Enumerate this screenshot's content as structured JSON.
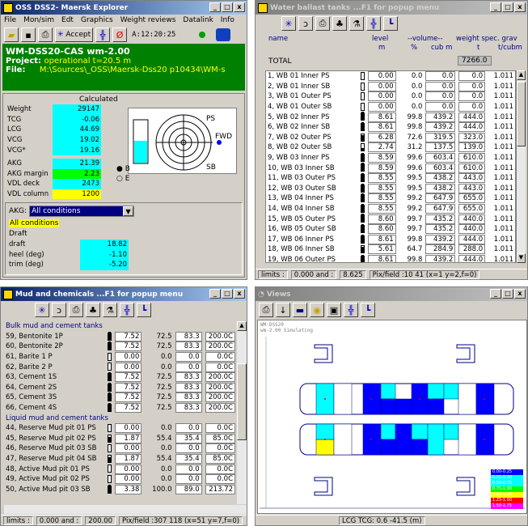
{
  "explorer": {
    "title": "OSS DSS2- Maersk Explorer",
    "menu": [
      "File",
      "Mon/sim",
      "Edt",
      "Graphics",
      "Weight reviews",
      "Datalink",
      "Info"
    ],
    "accept_label": "Accept",
    "time": "A:12:20:25",
    "header_name": "WM-DSS20-CAS wm-2.00",
    "project_label": "Project:",
    "project_value": "operational t=20.5 m",
    "file_label": "File:",
    "file_value": "M:\\Sources\\_OSS\\Maersk-Dss20 p10434\\WM-s",
    "calculated_label": "Calculated",
    "rows": [
      {
        "label": "Weight",
        "value": "29147"
      },
      {
        "label": "TCG",
        "value": "-0.06"
      },
      {
        "label": "LCG",
        "value": "44.69"
      },
      {
        "label": "VCG",
        "value": "19.02"
      },
      {
        "label": "VCG*",
        "value": "19.16"
      }
    ],
    "rows2": [
      {
        "label": "AKG",
        "value": "21.39",
        "color": "cyan"
      },
      {
        "label": "AKG margin",
        "value": "2.23",
        "color": "green"
      },
      {
        "label": "VDL deck",
        "value": "2473",
        "color": "cyan"
      },
      {
        "label": "VDL column",
        "value": "1200",
        "color": "yellow"
      }
    ],
    "compass": {
      "ps": "PS",
      "fwd": "FWD",
      "sb": "SB"
    },
    "radio_b": "B",
    "radio_e": "E",
    "akg_label": "AKG:",
    "akg_select": "All conditions",
    "all_conditions": "All conditions",
    "draft_header": "Draft",
    "draft_rows": [
      {
        "label": "draft",
        "value": "18.82"
      },
      {
        "label": "heel (deg)",
        "value": "-1.10"
      },
      {
        "label": "trim (deg)",
        "value": "-5.20"
      }
    ]
  },
  "ballast": {
    "title": "Water ballast tanks ...F1 for popup menu",
    "headers": {
      "name": "name",
      "level": "level",
      "level_unit": "m",
      "volume": "--volume--",
      "pct": "%",
      "cubm": "cub m",
      "weight": "weight spec. grav",
      "t": "t",
      "tcubm": "t/cubm"
    },
    "total_label": "TOTAL",
    "total_value": "7266.0",
    "rows": [
      {
        "name": "1, WB 01 Inner PS",
        "lv": "0.00",
        "pct": "0.0",
        "cub": "0.0",
        "w": "0.0",
        "g": "1.011",
        "fill": 0
      },
      {
        "name": "2, WB 01 Inner SB",
        "lv": "0.00",
        "pct": "0.0",
        "cub": "0.0",
        "w": "0.0",
        "g": "1.011",
        "fill": 0
      },
      {
        "name": "3, WB 01 Outer PS",
        "lv": "0.00",
        "pct": "0.0",
        "cub": "0.0",
        "w": "0.0",
        "g": "1.011",
        "fill": 0
      },
      {
        "name": "4, WB 01 Outer SB",
        "lv": "0.00",
        "pct": "0.0",
        "cub": "0.0",
        "w": "0.0",
        "g": "1.011",
        "fill": 0
      },
      {
        "name": "5, WB 02 Inner PS",
        "lv": "8.61",
        "pct": "99.8",
        "cub": "439.2",
        "w": "444.0",
        "g": "1.011",
        "fill": 1
      },
      {
        "name": "6, WB 02 Inner SB",
        "lv": "8.61",
        "pct": "99.8",
        "cub": "439.2",
        "w": "444.0",
        "g": "1.011",
        "fill": 1
      },
      {
        "name": "7, WB 02 Outer PS",
        "lv": "6.28",
        "pct": "72.6",
        "cub": "319.5",
        "w": "323.0",
        "g": "1.011",
        "fill": 0.73
      },
      {
        "name": "8, WB 02 Outer SB",
        "lv": "2.74",
        "pct": "31.2",
        "cub": "137.5",
        "w": "139.0",
        "g": "1.011",
        "fill": 0.31
      },
      {
        "name": "9, WB 03 Inner PS",
        "lv": "8.59",
        "pct": "99.6",
        "cub": "603.4",
        "w": "610.0",
        "g": "1.011",
        "fill": 1
      },
      {
        "name": "10, WB 03 Inner SB",
        "lv": "8.59",
        "pct": "99.6",
        "cub": "603.4",
        "w": "610.0",
        "g": "1.011",
        "fill": 1
      },
      {
        "name": "11, WB 03 Outer PS",
        "lv": "8.55",
        "pct": "99.5",
        "cub": "438.2",
        "w": "443.0",
        "g": "1.011",
        "fill": 1
      },
      {
        "name": "12, WB 03 Outer SB",
        "lv": "8.55",
        "pct": "99.5",
        "cub": "438.2",
        "w": "443.0",
        "g": "1.011",
        "fill": 1
      },
      {
        "name": "13, WB 04 Inner PS",
        "lv": "8.55",
        "pct": "99.2",
        "cub": "647.9",
        "w": "655.0",
        "g": "1.011",
        "fill": 1
      },
      {
        "name": "14, WB 04 Inner SB",
        "lv": "8.55",
        "pct": "99.2",
        "cub": "647.9",
        "w": "655.0",
        "g": "1.011",
        "fill": 1
      },
      {
        "name": "15, WB 05 Outer PS",
        "lv": "8.60",
        "pct": "99.7",
        "cub": "435.2",
        "w": "440.0",
        "g": "1.011",
        "fill": 1
      },
      {
        "name": "16, WB 05 Outer SB",
        "lv": "8.60",
        "pct": "99.7",
        "cub": "435.2",
        "w": "440.0",
        "g": "1.011",
        "fill": 1
      },
      {
        "name": "17, WB 06 Inner PS",
        "lv": "8.61",
        "pct": "99.8",
        "cub": "439.2",
        "w": "444.0",
        "g": "1.011",
        "fill": 1
      },
      {
        "name": "18, WB 06 Inner SB",
        "lv": "5.61",
        "pct": "64.7",
        "cub": "284.9",
        "w": "288.0",
        "g": "1.011",
        "fill": 0.65
      },
      {
        "name": "19, WB 06 Outer PS",
        "lv": "8.61",
        "pct": "99.8",
        "cub": "439.2",
        "w": "444.0",
        "g": "1.011",
        "fill": 1
      }
    ],
    "status": {
      "limits": "limits :",
      "range": "0.000 and :",
      "max": "8.625",
      "pix": "Pix/field :10  41 (x=1 y=2,f=0)"
    }
  },
  "mud": {
    "title": "Mud and chemicals ...F1 for popup menu",
    "sections": [
      {
        "header": "Bulk mud and cement tanks",
        "rows": [
          {
            "name": "59, Bentonite 1P",
            "a": "7.52",
            "b": "72.5",
            "c": "83.3",
            "d": "200.0C",
            "fill": 1
          },
          {
            "name": "60, Bentonite 2P",
            "a": "7.52",
            "b": "72.5",
            "c": "83.3",
            "d": "200.0C",
            "fill": 1
          },
          {
            "name": "61, Barite 1 P",
            "a": "0.00",
            "b": "0.0",
            "c": "0.0",
            "d": "0.0C",
            "fill": 0
          },
          {
            "name": "62, Barite 2 P",
            "a": "0.00",
            "b": "0.0",
            "c": "0.0",
            "d": "0.0C",
            "fill": 0
          },
          {
            "name": "63, Cement 1S",
            "a": "7.52",
            "b": "72.5",
            "c": "83.3",
            "d": "200.0C",
            "fill": 1
          },
          {
            "name": "64, Cement 2S",
            "a": "7.52",
            "b": "72.5",
            "c": "83.3",
            "d": "200.0C",
            "fill": 1
          },
          {
            "name": "65, Cement 3S",
            "a": "7.52",
            "b": "72.5",
            "c": "83.3",
            "d": "200.0C",
            "fill": 1
          },
          {
            "name": "66, Cement 4S",
            "a": "7.52",
            "b": "72.5",
            "c": "83.3",
            "d": "200.0C",
            "fill": 1
          }
        ]
      },
      {
        "header": "Liquid mud and cement tanks",
        "rows": [
          {
            "name": "44, Reserve Mud pit 01 PS",
            "a": "0.00",
            "b": "0.0",
            "c": "0.0",
            "d": "0.0C",
            "fill": 0
          },
          {
            "name": "45, Reserve Mud pit 02 PS",
            "a": "1.87",
            "b": "55.4",
            "c": "35.4",
            "d": "85.0C",
            "fill": 0.55
          },
          {
            "name": "46, Reserve Mud pit 03 SB",
            "a": "0.00",
            "b": "0.0",
            "c": "0.0",
            "d": "0.0C",
            "fill": 0
          },
          {
            "name": "47, Reserve Mud pit 04 SB",
            "a": "1.87",
            "b": "55.4",
            "c": "35.4",
            "d": "85.0C",
            "fill": 0.55
          },
          {
            "name": "48, Active Mud pit 01 PS",
            "a": "0.00",
            "b": "0.0",
            "c": "0.0",
            "d": "0.0C",
            "fill": 0
          },
          {
            "name": "49, Active Mud pit 02 PS",
            "a": "0.00",
            "b": "0.0",
            "c": "0.0",
            "d": "0.0C",
            "fill": 0
          },
          {
            "name": "50, Active Mud pit 03 SB",
            "a": "3.38",
            "b": "100.0",
            "c": "89.0",
            "d": "213.72",
            "fill": 1
          }
        ]
      }
    ],
    "status": {
      "limits": "limits :",
      "range": "0.000 and :",
      "max": "200.00",
      "pix": "Pix/field :307  118 (x=51 y=7,f=0)"
    }
  },
  "views": {
    "title": "Views",
    "header1": "WM-DSS20",
    "header2": "wm-2.00   Simulating",
    "status": "LCG TCG:  0.6 -41.5 (m)",
    "legend": [
      "0.00-0.25",
      "0.25-0.50",
      "0.50-0.75",
      "0.75-1.00",
      "1.00-1.25",
      "1.25-1.50",
      "1.50-1.75"
    ]
  }
}
